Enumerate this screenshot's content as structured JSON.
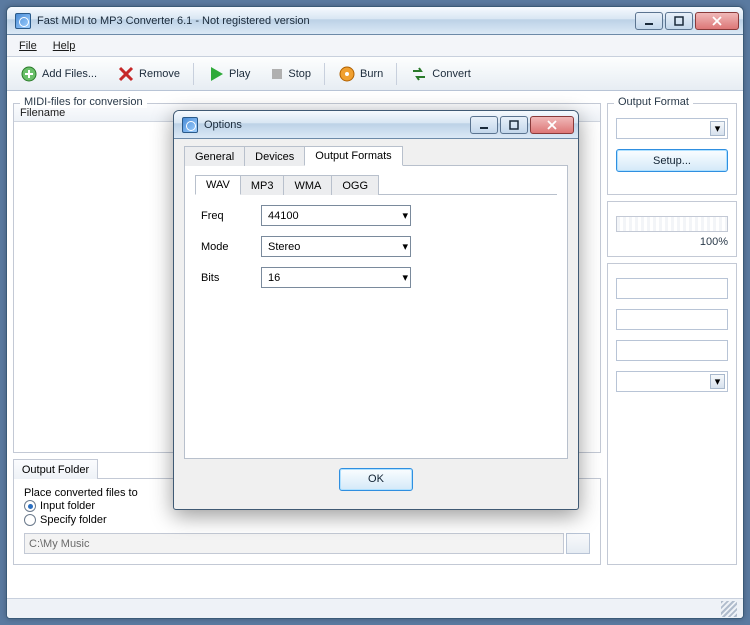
{
  "window": {
    "title": "Fast MIDI to MP3 Converter 6.1 - Not registered version"
  },
  "menu": {
    "file": "File",
    "help": "Help"
  },
  "toolbar": {
    "add": "Add Files...",
    "remove": "Remove",
    "play": "Play",
    "stop": "Stop",
    "burn": "Burn",
    "convert": "Convert"
  },
  "main": {
    "list_label": "MIDI-files for conversion",
    "filename_col": "Filename",
    "output_folder_tab": "Output Folder",
    "place_label": "Place converted files to",
    "radio_input": "Input folder",
    "radio_specify": "Specify folder",
    "path": "C:\\My Music"
  },
  "right": {
    "output_format": "Output Format",
    "setup": "Setup...",
    "progress": "100%"
  },
  "dialog": {
    "title": "Options",
    "tabs": {
      "general": "General",
      "devices": "Devices",
      "formats": "Output Formats"
    },
    "subtabs": {
      "wav": "WAV",
      "mp3": "MP3",
      "wma": "WMA",
      "ogg": "OGG"
    },
    "freq_label": "Freq",
    "freq_value": "44100",
    "mode_label": "Mode",
    "mode_value": "Stereo",
    "bits_label": "Bits",
    "bits_value": "16",
    "ok": "OK"
  }
}
